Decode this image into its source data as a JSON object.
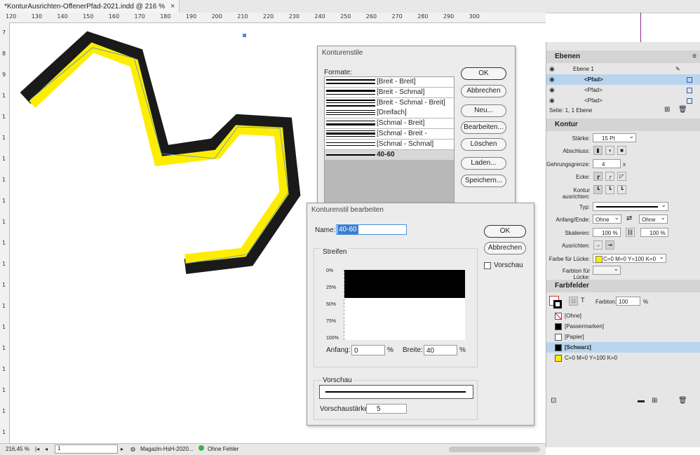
{
  "tab": {
    "title": "*KonturAusrichten-OffenerPfad-2021.indd @ 216 %",
    "close": "×"
  },
  "ruler": {
    "top": [
      "120",
      "130",
      "140",
      "150",
      "160",
      "170",
      "180",
      "190",
      "200",
      "210",
      "220",
      "230",
      "240",
      "250",
      "260",
      "270",
      "280",
      "290",
      "300"
    ],
    "left": [
      "7",
      "8",
      "9",
      "1",
      "1",
      "1",
      "1",
      "1",
      "1",
      "1",
      "1",
      "1",
      "1",
      "1",
      "1",
      "1",
      "1",
      "1",
      "1",
      "1"
    ]
  },
  "colors": {
    "yellow": "#ffed00",
    "black": "#1a1a1a",
    "accent": "#b9d4ee"
  },
  "konturenstile": {
    "title": "Konturenstile",
    "formate_label": "Formate:",
    "items": [
      {
        "name": "[Breit - Breit]",
        "style": "breit-breit"
      },
      {
        "name": "[Breit - Schmal]",
        "style": "breit-schmal"
      },
      {
        "name": "[Breit - Schmal - Breit]",
        "style": "breit-schmal-breit"
      },
      {
        "name": "[Dreifach]",
        "style": "dreifach"
      },
      {
        "name": "[Schmal - Breit]",
        "style": "schmal-breit"
      },
      {
        "name": "[Schmal - Breit - Schmal]",
        "style": "schmal-breit-schmal"
      },
      {
        "name": "[Schmal - Schmal]",
        "style": "schmal-schmal"
      },
      {
        "name": "40-60",
        "style": "single",
        "selected": true
      }
    ],
    "buttons": {
      "ok": "OK",
      "abbrechen": "Abbrechen",
      "neu": "Neu...",
      "bearbeiten": "Bearbeiten...",
      "loeschen": "Löschen",
      "laden": "Laden...",
      "speichern": "Speichern..."
    }
  },
  "edit_dialog": {
    "title": "Konturenstil bearbeiten",
    "name_label": "Name:",
    "name_value": "40-60",
    "streifen_label": "Streifen",
    "percent_labels": [
      "0%",
      "25%",
      "50%",
      "75%",
      "100%"
    ],
    "stripe": {
      "start_percent": 0,
      "width_percent": 40
    },
    "anfang_label": "Anfang:",
    "anfang_value": "0",
    "breite_label": "Breite:",
    "breite_value": "40",
    "unit": "%",
    "vorschau_group": "Vorschau",
    "vorschaustaerke_label": "Vorschaustärke:",
    "vorschaustaerke_value": "5",
    "vorschau_checkbox": "Vorschau",
    "ok": "OK",
    "abbrechen": "Abbrechen"
  },
  "ebenen": {
    "title": "Ebenen",
    "layer": "Ebene 1",
    "items": [
      "<Pfad>",
      "<Pfad>",
      "<Pfad>"
    ],
    "footer": "Seite: 1, 1 Ebene"
  },
  "kontur": {
    "title": "Kontur",
    "staerke_label": "Stärke:",
    "staerke_value": "15 Pt",
    "abschluss_label": "Abschluss:",
    "gehrung_label": "Gehrungsgrenze:",
    "gehrung_value": "4",
    "gehrung_unit": "x",
    "ecke_label": "Ecke:",
    "ausrichten_label": "Kontur ausrichten:",
    "typ_label": "Typ:",
    "anfang_ende_label": "Anfang/Ende:",
    "anfang_value": "Ohne",
    "ende_value": "Ohne",
    "skalieren_label": "Skalieren:",
    "skalieren_a": "100 %",
    "skalieren_b": "100 %",
    "ausrichten2_label": "Ausrichten:",
    "luecke_label": "Farbe für Lücke:",
    "luecke_value": "C=0 M=0 Y=100 K=0",
    "farbton_luecke_label": "Farbton für Lücke:"
  },
  "farbfelder": {
    "title": "Farbfelder",
    "farbton_label": "Farbton:",
    "farbton_value": "100",
    "unit": "%",
    "swatches": [
      {
        "name": "[Ohne]",
        "color": "none"
      },
      {
        "name": "[Passermarken]",
        "color": "#000000"
      },
      {
        "name": "[Papier]",
        "color": "#ffffff"
      },
      {
        "name": "[Schwarz]",
        "color": "#000000",
        "selected": true
      },
      {
        "name": "C=0 M=0 Y=100 K=0",
        "color": "#ffed00"
      }
    ]
  },
  "status": {
    "zoom": "216,45 %",
    "page": "1",
    "file": "Magazin-HsH-2020...",
    "errors": "Ohne Fehler"
  }
}
